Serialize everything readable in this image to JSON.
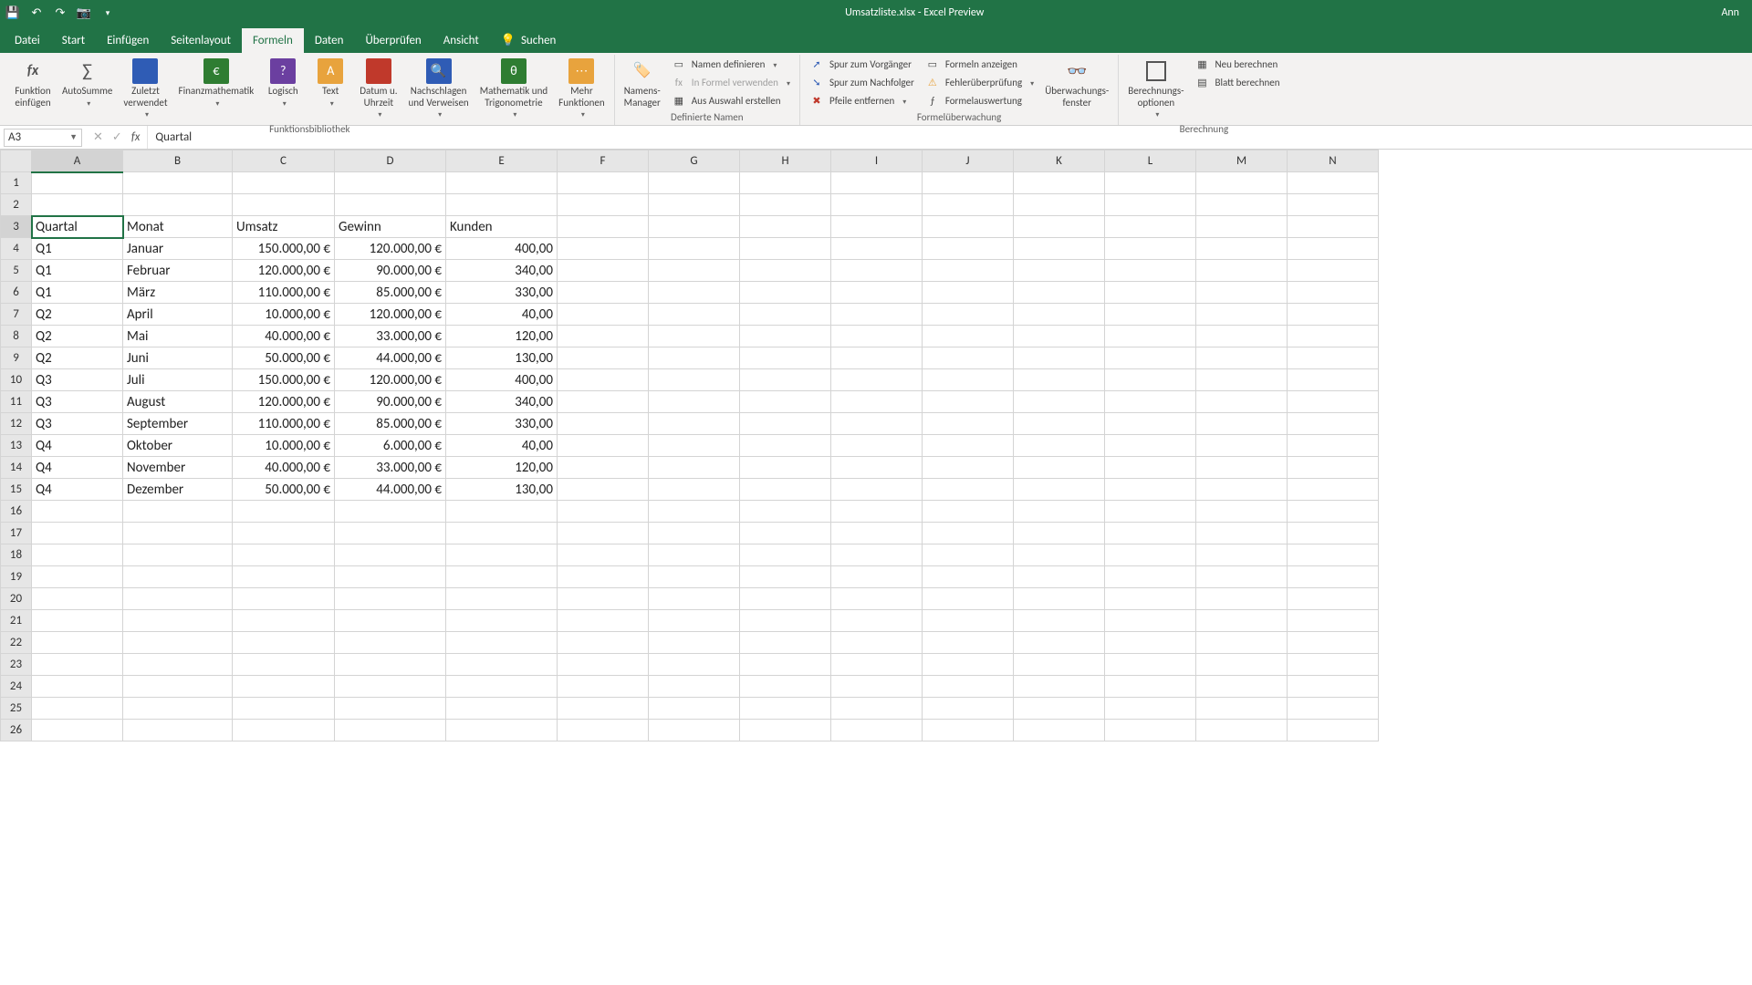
{
  "titlebar": {
    "filename": "Umsatzliste.xlsx",
    "app": "Excel Preview",
    "user": "Ann"
  },
  "tabs": {
    "file": "Datei",
    "items": [
      "Start",
      "Einfügen",
      "Seitenlayout",
      "Formeln",
      "Daten",
      "Überprüfen",
      "Ansicht"
    ],
    "active": "Formeln",
    "search": "Suchen"
  },
  "ribbon": {
    "lib": {
      "insertfn1": "Funktion",
      "insertfn2": "einfügen",
      "autosum": "AutoSumme",
      "recent1": "Zuletzt",
      "recent2": "verwendet",
      "financial": "Finanzmathematik",
      "logical": "Logisch",
      "text": "Text",
      "date1": "Datum u.",
      "date2": "Uhrzeit",
      "lookup1": "Nachschlagen",
      "lookup2": "und Verweisen",
      "math1": "Mathematik und",
      "math2": "Trigonometrie",
      "more1": "Mehr",
      "more2": "Funktionen",
      "group": "Funktionsbibliothek"
    },
    "names": {
      "mgr1": "Namens-",
      "mgr2": "Manager",
      "define": "Namen definieren",
      "useinf": "In Formel verwenden",
      "fromsel": "Aus Auswahl erstellen",
      "group": "Definierte Namen"
    },
    "audit": {
      "traceprec": "Spur zum Vorgänger",
      "tracedep": "Spur zum Nachfolger",
      "removearr": "Pfeile entfernen",
      "showf": "Formeln anzeigen",
      "errchk": "Fehlerüberprüfung",
      "evalf": "Formelauswertung",
      "watch1": "Überwachungs-",
      "watch2": "fenster",
      "group": "Formelüberwachung"
    },
    "calc": {
      "opts1": "Berechnungs-",
      "opts2": "optionen",
      "now": "Neu berechnen",
      "sheet": "Blatt berechnen",
      "group": "Berechnung"
    }
  },
  "fbar": {
    "name": "A3",
    "formula": "Quartal"
  },
  "grid": {
    "cols": [
      "A",
      "B",
      "C",
      "D",
      "E",
      "F",
      "G",
      "H",
      "I",
      "J",
      "K",
      "L",
      "M",
      "N"
    ],
    "rows": 26,
    "selected": {
      "row": 3,
      "col": 0
    },
    "headers": [
      "Quartal",
      "Monat",
      "Umsatz",
      "Gewinn",
      "Kunden"
    ],
    "data": [
      {
        "q": "Q1",
        "m": "Januar",
        "u": "150.000,00 €",
        "g": "120.000,00 €",
        "k": "400,00"
      },
      {
        "q": "Q1",
        "m": "Februar",
        "u": "120.000,00 €",
        "g": "90.000,00 €",
        "k": "340,00"
      },
      {
        "q": "Q1",
        "m": "März",
        "u": "110.000,00 €",
        "g": "85.000,00 €",
        "k": "330,00"
      },
      {
        "q": "Q2",
        "m": "April",
        "u": "10.000,00 €",
        "g": "120.000,00 €",
        "k": "40,00"
      },
      {
        "q": "Q2",
        "m": "Mai",
        "u": "40.000,00 €",
        "g": "33.000,00 €",
        "k": "120,00"
      },
      {
        "q": "Q2",
        "m": "Juni",
        "u": "50.000,00 €",
        "g": "44.000,00 €",
        "k": "130,00"
      },
      {
        "q": "Q3",
        "m": "Juli",
        "u": "150.000,00 €",
        "g": "120.000,00 €",
        "k": "400,00"
      },
      {
        "q": "Q3",
        "m": "August",
        "u": "120.000,00 €",
        "g": "90.000,00 €",
        "k": "340,00"
      },
      {
        "q": "Q3",
        "m": "September",
        "u": "110.000,00 €",
        "g": "85.000,00 €",
        "k": "330,00"
      },
      {
        "q": "Q4",
        "m": "Oktober",
        "u": "10.000,00 €",
        "g": "6.000,00 €",
        "k": "40,00"
      },
      {
        "q": "Q4",
        "m": "November",
        "u": "40.000,00 €",
        "g": "33.000,00 €",
        "k": "120,00"
      },
      {
        "q": "Q4",
        "m": "Dezember",
        "u": "50.000,00 €",
        "g": "44.000,00 €",
        "k": "130,00"
      }
    ]
  }
}
